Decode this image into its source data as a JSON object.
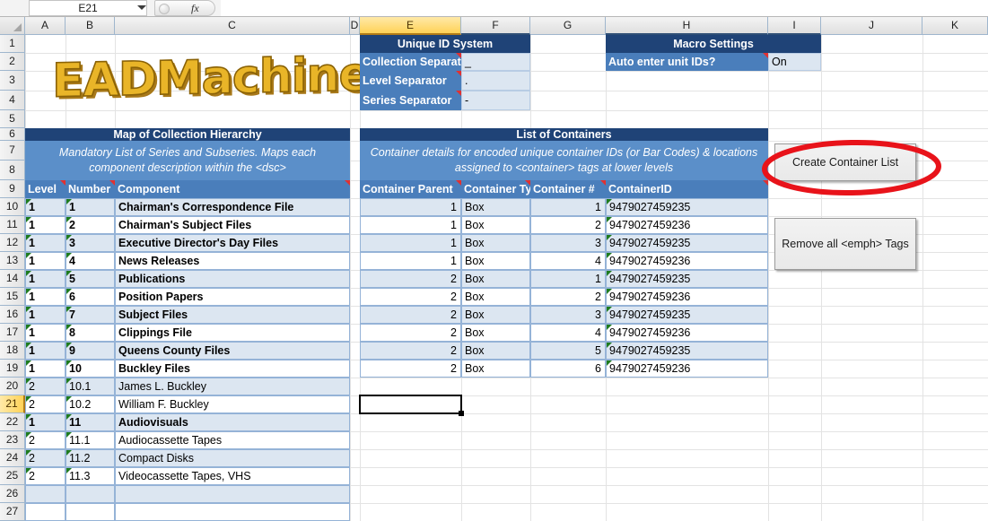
{
  "formula_bar": {
    "name_box_value": "E21",
    "formula_value": "",
    "fx_label": "fx"
  },
  "grid": {
    "columns": [
      "A",
      "B",
      "C",
      "D",
      "E",
      "F",
      "G",
      "H",
      "I",
      "J",
      "K"
    ],
    "active_column": "E",
    "rows": [
      "1",
      "2",
      "3",
      "4",
      "5",
      "6",
      "7",
      "8",
      "9",
      "10",
      "11",
      "12",
      "13",
      "14",
      "15",
      "16",
      "17",
      "18",
      "19",
      "20",
      "21",
      "22",
      "23",
      "24",
      "25",
      "26",
      "27"
    ],
    "active_row": "21"
  },
  "logo": {
    "text": "EADMachine",
    "color": "#E9B528",
    "outline_color": "#8A6206"
  },
  "unique_id_system": {
    "title": "Unique ID System",
    "rows": [
      {
        "label": "Collection Separator",
        "value": "_"
      },
      {
        "label": "Level Separator",
        "value": "."
      },
      {
        "label": "Series Separator",
        "value": "-"
      }
    ]
  },
  "macro_settings": {
    "title": "Macro Settings",
    "rows": [
      {
        "label": "Auto enter unit IDs?",
        "value": "On"
      }
    ]
  },
  "collection_hierarchy": {
    "title": "Map of Collection Hierarchy",
    "subtitle": "Mandatory List of Series and Subseries. Maps each component description within the <dsc>",
    "headers": [
      "Level",
      "Number",
      "Component"
    ],
    "rows": [
      {
        "level": "1",
        "number": "1",
        "component": "Chairman's Correspondence File",
        "bold": true
      },
      {
        "level": "1",
        "number": "2",
        "component": "Chairman's Subject Files",
        "bold": true
      },
      {
        "level": "1",
        "number": "3",
        "component": "Executive Director's Day Files",
        "bold": true
      },
      {
        "level": "1",
        "number": "4",
        "component": "News Releases",
        "bold": true
      },
      {
        "level": "1",
        "number": "5",
        "component": "Publications",
        "bold": true
      },
      {
        "level": "1",
        "number": "6",
        "component": "Position Papers",
        "bold": true
      },
      {
        "level": "1",
        "number": "7",
        "component": "Subject Files",
        "bold": true
      },
      {
        "level": "1",
        "number": "8",
        "component": "Clippings File",
        "bold": true
      },
      {
        "level": "1",
        "number": "9",
        "component": "Queens County Files",
        "bold": true
      },
      {
        "level": "1",
        "number": "10",
        "component": "Buckley Files",
        "bold": true
      },
      {
        "level": "2",
        "number": "10.1",
        "component": "James L. Buckley",
        "bold": false
      },
      {
        "level": "2",
        "number": "10.2",
        "component": "William F. Buckley",
        "bold": false
      },
      {
        "level": "1",
        "number": "11",
        "component": "Audiovisuals",
        "bold": true
      },
      {
        "level": "2",
        "number": "11.1",
        "component": "Audiocassette Tapes",
        "bold": false
      },
      {
        "level": "2",
        "number": "11.2",
        "component": "Compact Disks",
        "bold": false
      },
      {
        "level": "2",
        "number": "11.3",
        "component": "Videocassette Tapes, VHS",
        "bold": false
      },
      {
        "level": "",
        "number": "",
        "component": "",
        "bold": false
      },
      {
        "level": "",
        "number": "",
        "component": "",
        "bold": false
      }
    ]
  },
  "container_list": {
    "title": "List of Containers",
    "subtitle": "Container details for encoded unique container IDs (or Bar Codes) & locations assigned to <container> tags at lower levels",
    "headers": [
      "Container Parent",
      "Container Type",
      "Container #",
      "ContainerID"
    ],
    "rows": [
      {
        "parent": "1",
        "type": "Box",
        "number": "1",
        "id": "9479027459235"
      },
      {
        "parent": "1",
        "type": "Box",
        "number": "2",
        "id": "9479027459236"
      },
      {
        "parent": "1",
        "type": "Box",
        "number": "3",
        "id": "9479027459235"
      },
      {
        "parent": "1",
        "type": "Box",
        "number": "4",
        "id": "9479027459236"
      },
      {
        "parent": "2",
        "type": "Box",
        "number": "1",
        "id": "9479027459235"
      },
      {
        "parent": "2",
        "type": "Box",
        "number": "2",
        "id": "9479027459236"
      },
      {
        "parent": "2",
        "type": "Box",
        "number": "3",
        "id": "9479027459235"
      },
      {
        "parent": "2",
        "type": "Box",
        "number": "4",
        "id": "9479027459236"
      },
      {
        "parent": "2",
        "type": "Box",
        "number": "5",
        "id": "9479027459235"
      },
      {
        "parent": "2",
        "type": "Box",
        "number": "6",
        "id": "9479027459236"
      }
    ]
  },
  "macro_buttons": [
    {
      "label": "Create Container List"
    },
    {
      "label": "Remove all <emph> Tags"
    }
  ],
  "annotation": {
    "shape": "ellipse",
    "color": "#E8131A",
    "target": "Create Container List"
  },
  "colors": {
    "header_dark": "#1F4377",
    "header_mid": "#5B8FC9",
    "header_cols": "#4A7EBB",
    "row_band": "#DCE6F1",
    "selection_col": "#FFD257"
  }
}
